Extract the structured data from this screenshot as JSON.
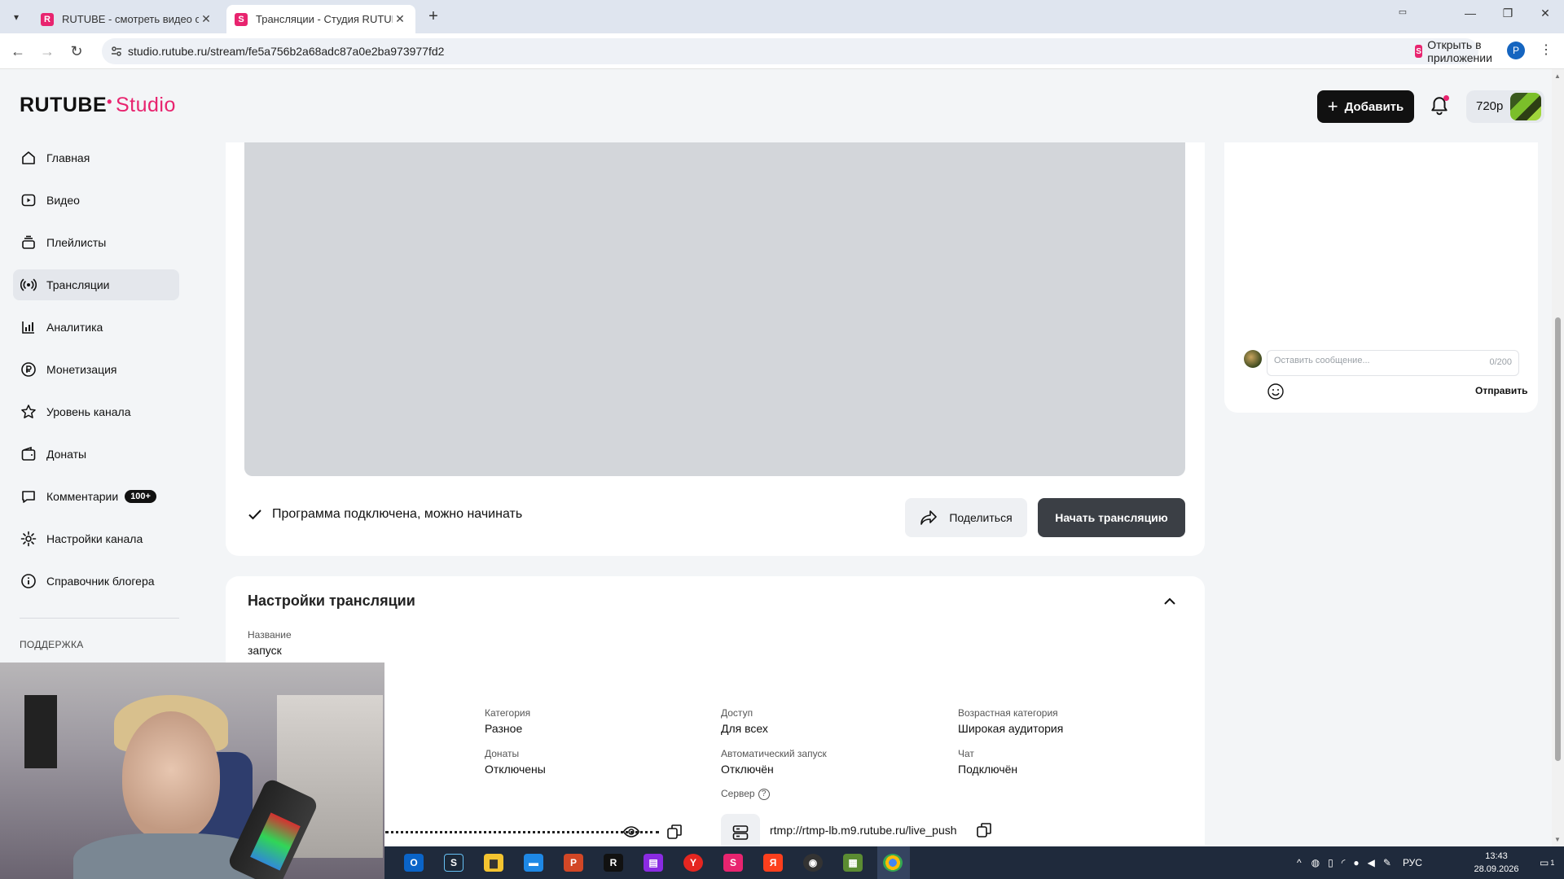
{
  "browser": {
    "tabs": [
      {
        "title": "RUTUBE - смотреть видео онлайн",
        "favicon": "R",
        "favicon_color": "#e8246f",
        "active": false
      },
      {
        "title": "Трансляции - Студия RUTUBE",
        "favicon": "S",
        "favicon_color": "#e8246f",
        "active": true
      }
    ],
    "url": "studio.rutube.ru/stream/fe5a756b2a68adc87a0e2ba973977fd2",
    "open_in_app": "Открыть в приложении",
    "profile_initial": "P"
  },
  "header": {
    "logo_main": "RUTUBE",
    "logo_studio": "Studio",
    "add_label": "Добавить",
    "quality": "720p"
  },
  "sidebar": {
    "items": [
      {
        "label": "Главная",
        "icon": "home-icon"
      },
      {
        "label": "Видео",
        "icon": "video-icon"
      },
      {
        "label": "Плейлисты",
        "icon": "playlist-icon"
      },
      {
        "label": "Трансляции",
        "icon": "broadcast-icon",
        "active": true
      },
      {
        "label": "Аналитика",
        "icon": "analytics-icon"
      },
      {
        "label": "Монетизация",
        "icon": "ruble-icon"
      },
      {
        "label": "Уровень канала",
        "icon": "star-icon"
      },
      {
        "label": "Донаты",
        "icon": "wallet-icon"
      },
      {
        "label": "Комментарии",
        "icon": "comment-icon",
        "badge": "100+"
      },
      {
        "label": "Настройки канала",
        "icon": "gear-icon"
      },
      {
        "label": "Справочник блогера",
        "icon": "info-icon"
      }
    ],
    "support_heading": "ПОДДЕРЖКА"
  },
  "stream": {
    "status": "Программа подключена, можно начинать",
    "share_label": "Поделиться",
    "start_label": "Начать трансляцию"
  },
  "settings": {
    "title": "Настройки трансляции",
    "name_label": "Название",
    "name_value": "запуск",
    "fields": {
      "category": {
        "label": "Категория",
        "value": "Разное"
      },
      "access": {
        "label": "Доступ",
        "value": "Для всех"
      },
      "age": {
        "label": "Возрастная категория",
        "value": "Широкая аудитория"
      },
      "donations": {
        "label": "Донаты",
        "value": "Отключены"
      },
      "autostart": {
        "label": "Автоматический запуск",
        "value": "Отключён"
      },
      "chat": {
        "label": "Чат",
        "value": "Подключён"
      },
      "server": {
        "label": "Сервер",
        "value": "rtmp://rtmp-lb.m9.rutube.ru/live_push"
      }
    }
  },
  "chat": {
    "placeholder": "Оставить сообщение...",
    "counter": "0/200",
    "send_label": "Отправить"
  },
  "taskbar": {
    "language": "РУС",
    "time": "13:43",
    "date": "28.09.2026",
    "notifications": "1"
  },
  "colors": {
    "brand": "#e8246f",
    "dark_button": "#111111",
    "start_button": "#3b3f45"
  }
}
